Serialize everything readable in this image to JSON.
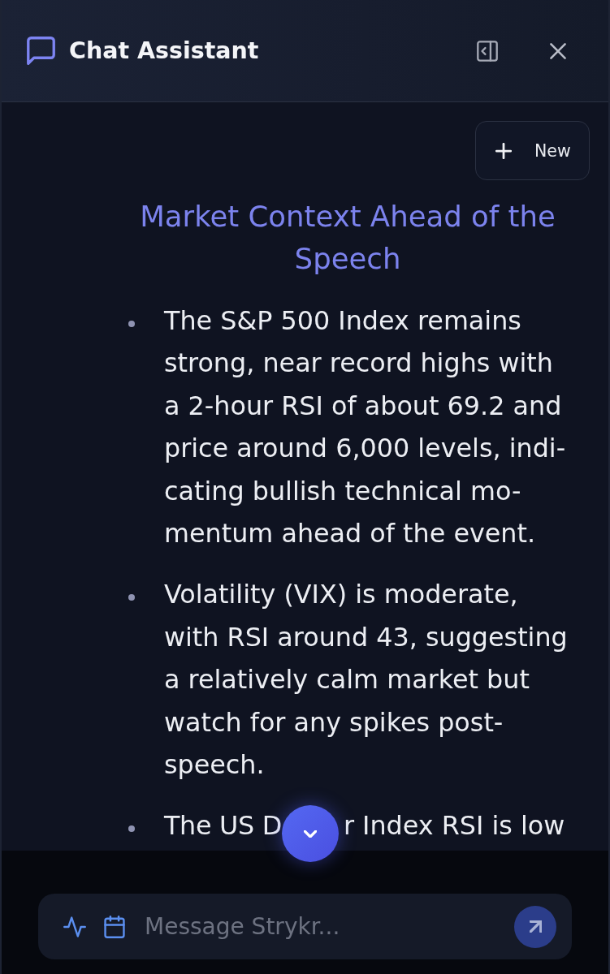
{
  "header": {
    "title": "Chat Assistant"
  },
  "new_button": {
    "label": "New"
  },
  "message": {
    "heading": "Market Context Ahead of the Speech",
    "bullets": [
      {
        "kind": "paragraph",
        "text": "The S&P 500 Index remains strong, near record highs with a 2-hour RSI of about 69.2 and price around 6,000 levels, indi-cating bullish technical mo-mentum ahead of the event."
      },
      {
        "kind": "paragraph",
        "text": "Volatility (VIX) is moderate, with RSI around 43, suggesting a relatively calm market but watch for any spikes post-speech."
      },
      {
        "kind": "covered",
        "parts": [
          "The US D",
          "r Index RSI is low"
        ]
      }
    ]
  },
  "composer": {
    "placeholder": "Message Strykr..."
  }
}
